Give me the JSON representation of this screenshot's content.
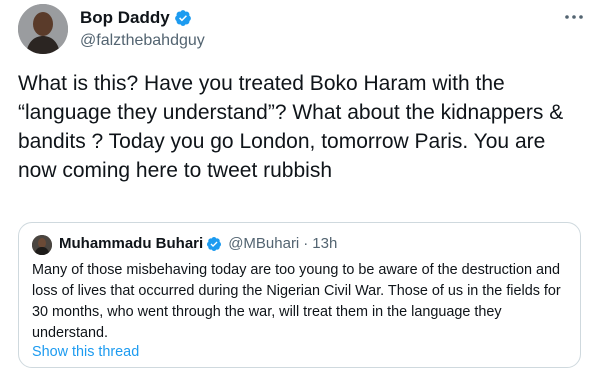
{
  "author": {
    "name": "Bop Daddy",
    "handle": "@falzthebahdguy"
  },
  "tweet": {
    "text": "What is this? Have you treated Boko Haram with the “language they understand”? What about the kidnappers & bandits ? Today you go London, tomorrow Paris. You are now coming here to tweet rubbish"
  },
  "quoted_tweet": {
    "name": "Muhammadu Buhari",
    "handle": "@MBuhari",
    "separator": "·",
    "time": "13h",
    "text": "Many of those misbehaving today are too young to be aware of the destruction and loss of lives that occurred during the Nigerian Civil War. Those of us in the fields for 30 months, who went through the war, will treat them in the language they understand.",
    "show_thread_label": "Show this thread"
  },
  "icons": {
    "verified": "verified-badge-icon",
    "more": "more-options-icon"
  },
  "colors": {
    "text_primary": "#0f1419",
    "text_secondary": "#536471",
    "link": "#1d9bf0",
    "verified": "#1d9bf0",
    "border": "#cfd9de"
  }
}
